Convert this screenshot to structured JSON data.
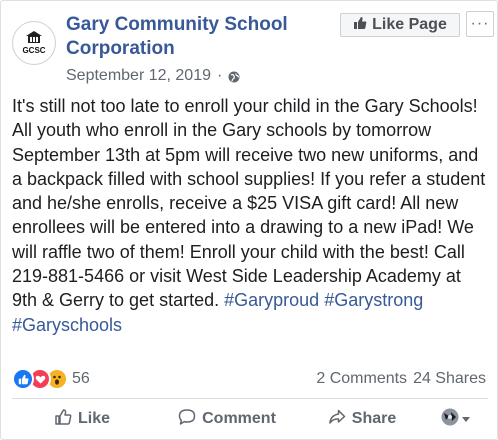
{
  "page": {
    "name": "Gary Community School Corporation",
    "avatar_text": "GCSC",
    "date": "September 12, 2019",
    "meta_sep": "·",
    "like_page_label": "Like Page",
    "more_label": "···"
  },
  "post": {
    "text": "It's still not too late to enroll your child in the Gary Schools! All youth who enroll in the Gary schools by tomorrow September 13th at 5pm will receive two new uniforms, and a backpack filled with school supplies! If you refer a student and he/she enrolls, receive a $25 VISA gift card! All new enrollees will be entered into a drawing to a new iPad! We will raffle two of them! Enroll your child with the best! Call 219-881-5466 or visit West Side Leadership Academy at 9th & Gerry to get started. ",
    "hashtags": [
      "#Garyproud",
      "#Garystrong",
      "#Garyschools"
    ]
  },
  "stats": {
    "reaction_count": "56",
    "comments": "2 Comments",
    "shares": "24 Shares",
    "reaction_icons": [
      "like-icon",
      "love-icon",
      "wow-icon"
    ]
  },
  "actions": {
    "like": "Like",
    "comment": "Comment",
    "share": "Share"
  },
  "colors": {
    "link": "#385898",
    "secondary_text": "#606770",
    "like_blue": "#1877f2",
    "love_red": "#f33e58",
    "wow_yellow": "#f7b125"
  }
}
